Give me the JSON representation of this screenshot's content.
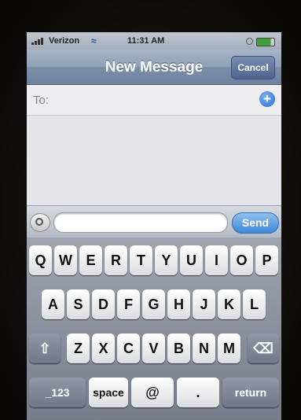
{
  "status_bar": {
    "carrier": "Verizon",
    "time": "11:31 AM",
    "wifi_icon": "wifi-icon",
    "battery_icon": "battery-icon"
  },
  "nav": {
    "title": "New Message",
    "cancel_label": "Cancel"
  },
  "to_row": {
    "label": "To:",
    "add_icon": "plus-circle-icon",
    "add_glyph": "+"
  },
  "compose": {
    "camera_icon": "camera-icon",
    "message_value": "",
    "send_label": "Send"
  },
  "keyboard": {
    "row1": [
      "Q",
      "W",
      "E",
      "R",
      "T",
      "Y",
      "U",
      "I",
      "O",
      "P"
    ],
    "row2": [
      "A",
      "S",
      "D",
      "F",
      "G",
      "H",
      "J",
      "K",
      "L"
    ],
    "row3": [
      "Z",
      "X",
      "C",
      "V",
      "B",
      "N",
      "M"
    ],
    "shift_glyph": "⇧",
    "delete_glyph": "⌫",
    "numbers_label": "_123",
    "space_label": "space",
    "at_label": "@",
    "dot_label": ".",
    "return_label": "return"
  }
}
